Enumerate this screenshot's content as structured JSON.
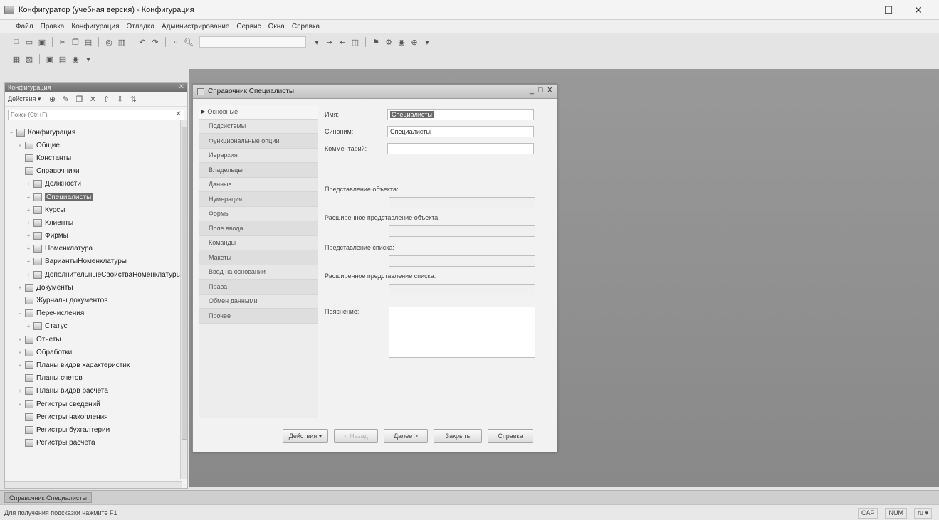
{
  "window": {
    "title": "Конфигуратор (учебная версия) - Конфигурация",
    "minimize": "–",
    "maximize": "☐",
    "close": "✕"
  },
  "menu": [
    "Файл",
    "Правка",
    "Конфигурация",
    "Отладка",
    "Администрирование",
    "Сервис",
    "Окна",
    "Справка"
  ],
  "tree_panel": {
    "title": "Конфигурация",
    "actions_label": "Действия ▾",
    "search_placeholder": "Поиск (Ctrl+F)",
    "items": [
      {
        "label": "Конфигурация",
        "level": 0,
        "exp": "−"
      },
      {
        "label": "Общие",
        "level": 1,
        "exp": "+"
      },
      {
        "label": "Константы",
        "level": 1,
        "exp": ""
      },
      {
        "label": "Справочники",
        "level": 1,
        "exp": "−"
      },
      {
        "label": "Должности",
        "level": 2,
        "exp": "+"
      },
      {
        "label": "Специалисты",
        "level": 2,
        "exp": "+",
        "selected": true
      },
      {
        "label": "Курсы",
        "level": 2,
        "exp": "+"
      },
      {
        "label": "Клиенты",
        "level": 2,
        "exp": "+"
      },
      {
        "label": "Фирмы",
        "level": 2,
        "exp": "+"
      },
      {
        "label": "Номенклатура",
        "level": 2,
        "exp": "+"
      },
      {
        "label": "ВариантыНоменклатуры",
        "level": 2,
        "exp": "+"
      },
      {
        "label": "ДополнительныеСвойстваНоменклатуры",
        "level": 2,
        "exp": "+"
      },
      {
        "label": "Документы",
        "level": 1,
        "exp": "+"
      },
      {
        "label": "Журналы документов",
        "level": 1,
        "exp": ""
      },
      {
        "label": "Перечисления",
        "level": 1,
        "exp": "−"
      },
      {
        "label": "Статус",
        "level": 2,
        "exp": "+"
      },
      {
        "label": "Отчеты",
        "level": 1,
        "exp": "+"
      },
      {
        "label": "Обработки",
        "level": 1,
        "exp": "+"
      },
      {
        "label": "Планы видов характеристик",
        "level": 1,
        "exp": "+"
      },
      {
        "label": "Планы счетов",
        "level": 1,
        "exp": ""
      },
      {
        "label": "Планы видов расчета",
        "level": 1,
        "exp": "+"
      },
      {
        "label": "Регистры сведений",
        "level": 1,
        "exp": "+"
      },
      {
        "label": "Регистры накопления",
        "level": 1,
        "exp": ""
      },
      {
        "label": "Регистры бухгалтерии",
        "level": 1,
        "exp": ""
      },
      {
        "label": "Регистры расчета",
        "level": 1,
        "exp": ""
      }
    ]
  },
  "dialog": {
    "title": "Справочник Специалисты",
    "win_buttons": [
      "_",
      "□",
      "X"
    ],
    "tabs": [
      "Основные",
      "Подсистемы",
      "Функциональные опции",
      "Иерархия",
      "Владельцы",
      "Данные",
      "Нумерация",
      "Формы",
      "Поле ввода",
      "Команды",
      "Макеты",
      "Ввод на основании",
      "Права",
      "Обмен данными",
      "Прочее"
    ],
    "fields": {
      "name_label": "Имя:",
      "name_value": "Специалисты",
      "synonym_label": "Синоним:",
      "synonym_value": "Специалисты",
      "comment_label": "Комментарий:",
      "comment_value": "",
      "object_repr_label": "Представление объекта:",
      "ext_object_repr_label": "Расширенное представление объекта:",
      "list_repr_label": "Представление списка:",
      "ext_list_repr_label": "Расширенное представление списка:",
      "explanation_label": "Пояснение:"
    },
    "buttons": {
      "actions": "Действия ▾",
      "back": "< Назад",
      "next": "Далее >",
      "close": "Закрыть",
      "help": "Справка"
    }
  },
  "taskbar": {
    "tab_label": "Справочник Специалисты"
  },
  "status": {
    "hint": "Для получения подсказки нажмите F1",
    "cap": "CAP",
    "num": "NUM",
    "lang": "ru ▾"
  }
}
